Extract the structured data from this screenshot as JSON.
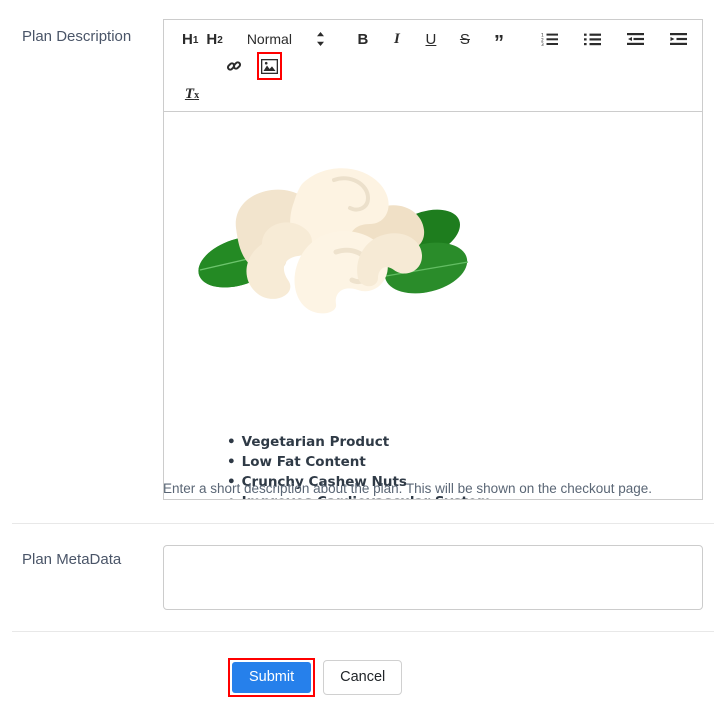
{
  "form": {
    "description_field": {
      "label": "Plan Description",
      "help_text": "Enter a short description about the plan. This will be shown on the checkout page."
    },
    "metadata_field": {
      "label": "Plan MetaData",
      "value": "",
      "placeholder": ""
    }
  },
  "editor": {
    "toolbar": {
      "h1_label": "H",
      "h1_sub": "1",
      "h2_label": "H",
      "h2_sub": "2",
      "format_select_value": "Normal",
      "bold_label": "B",
      "italic_label": "I",
      "underline_label": "U",
      "strike_label": "S",
      "blockquote_label": "”",
      "clear_format_label": "T",
      "clear_format_sub": "x",
      "icons": {
        "ordered_list": "ordered-list-icon",
        "bullet_list": "bullet-list-icon",
        "outdent": "outdent-icon",
        "indent": "indent-icon",
        "link": "link-icon",
        "image": "image-icon"
      }
    },
    "content": {
      "image_alt": "Cashew nuts with green leaves",
      "benefits": [
        "Vegetarian Product",
        "Low Fat Content",
        "Crunchy Cashew Nuts",
        "Improves Cardiovascular System"
      ]
    }
  },
  "actions": {
    "submit_label": "Submit",
    "cancel_label": "Cancel"
  },
  "colors": {
    "submit_background": "#2680eb",
    "highlight_border": "#ff0000",
    "label_text": "#4a5568",
    "border": "#cccccc"
  }
}
